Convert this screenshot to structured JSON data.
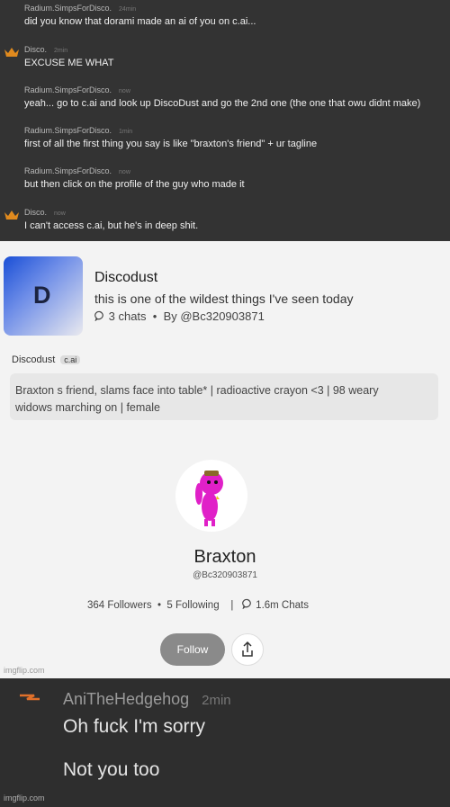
{
  "chat": {
    "messages": [
      {
        "user": "Radium.SimpsForDisco.",
        "time": "24min",
        "text": "did you know that dorami made an ai of you on c.ai...",
        "crown": false
      },
      {
        "user": "Disco.",
        "time": "2min",
        "text": "EXCUSE ME WHAT",
        "crown": true
      },
      {
        "user": "Radium.SimpsForDisco.",
        "time": "now",
        "text": "yeah... go to c.ai and look up DiscoDust and go the 2nd one (the one that owu didnt make)",
        "crown": false
      },
      {
        "user": "Radium.SimpsForDisco.",
        "time": "1min",
        "text": "first of all the first thing you say is like \"braxton's friend\" + ur tagline",
        "crown": false
      },
      {
        "user": "Radium.SimpsForDisco.",
        "time": "now",
        "text": "but then click on the profile of the guy who made it",
        "crown": false
      },
      {
        "user": "Disco.",
        "time": "now",
        "text": "I can't access c.ai, but he's in deep shit.",
        "crown": true
      }
    ]
  },
  "bot": {
    "avatar_letter": "D",
    "title": "Discodust",
    "description": "this is one of the wildest things I've seen today",
    "chats": "3 chats",
    "by": "By @Bc320903871",
    "name": "Discodust",
    "badge": "c.ai",
    "tagline": "Braxton s friend,  slams face into table* | radioactive crayon <3 | 98 weary widows marching on | female"
  },
  "profile": {
    "name": "Braxton",
    "handle": "@Bc320903871",
    "followers": "364 Followers",
    "following": "5 Following",
    "chats": "1.6m Chats",
    "follow_label": "Follow"
  },
  "watermark": "imgflip.com",
  "reply": {
    "user": "AniTheHedgehog",
    "time": "2min",
    "line1": "Oh fuck I'm sorry",
    "line2": "Not you too"
  },
  "colors": {
    "crown": "#e08a1e",
    "bolt": "#e0702a",
    "follow_bg": "#8a8a8a"
  }
}
